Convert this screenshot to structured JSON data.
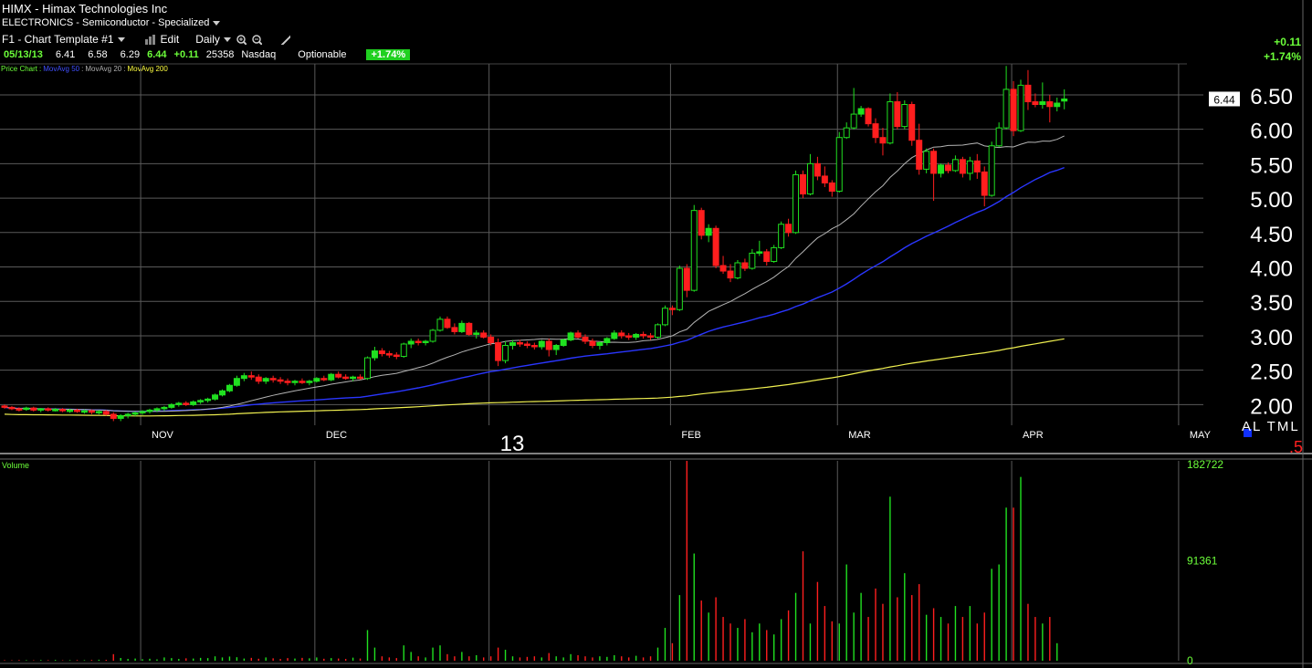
{
  "header": {
    "symbol": "HIMX",
    "company": "Himax Technologies Inc",
    "sector": "ELECTRONICS - Semiconductor - Specialized",
    "template": "F1 - Chart Template #1",
    "edit_label": "Edit",
    "period_label": "Daily",
    "quote": {
      "date": "05/13/13",
      "open": "6.41",
      "high": "6.58",
      "low": "6.29",
      "last": "6.44",
      "change": "+0.11",
      "volume": "25358",
      "exchange": "Nasdaq",
      "optionable": "Optionable",
      "pct_badge": "+1.74%"
    },
    "right_change": "+0.11",
    "right_pct": "+1.74%"
  },
  "legend": {
    "price_chart": "Price Chart",
    "ma50": "MovAvg 50",
    "ma20": "MovAvg 20",
    "ma200": "MovAvg 200"
  },
  "volume_label": "Volume",
  "altml": "AL TML",
  "red_label": ".5",
  "colors": {
    "up": "#20e020",
    "down": "#ff1e1e",
    "ma20": "#b4b4b4",
    "ma50": "#2a36ff",
    "ma200": "#f0f050",
    "grid": "#5a5a5a"
  },
  "chart_data": {
    "type": "candlestick",
    "price_axis": {
      "ticks": [
        "6.50",
        "6.00",
        "5.50",
        "5.00",
        "4.50",
        "4.00",
        "3.50",
        "3.00",
        "2.50",
        "2.00"
      ],
      "tick_values": [
        6.5,
        6.0,
        5.5,
        5.0,
        4.5,
        4.0,
        3.5,
        3.0,
        2.5,
        2.0
      ],
      "last_price_label": "6.44",
      "ylim": [
        1.7,
        6.95
      ]
    },
    "x_axis": {
      "labels": [
        "NOV",
        "DEC",
        "13",
        "FEB",
        "MAR",
        "APR",
        "MAY"
      ],
      "label_bar_index": [
        19,
        43,
        67,
        92,
        115,
        139,
        162
      ]
    },
    "volume_axis": {
      "ticks": [
        "182722",
        "91361",
        "0"
      ],
      "tick_values": [
        182722,
        91361,
        0
      ]
    },
    "candles": [
      [
        1.98,
        2.0,
        1.94,
        1.96
      ],
      [
        1.96,
        1.98,
        1.92,
        1.94
      ],
      [
        1.94,
        1.96,
        1.9,
        1.93
      ],
      [
        1.93,
        1.97,
        1.91,
        1.95
      ],
      [
        1.95,
        1.97,
        1.9,
        1.92
      ],
      [
        1.92,
        1.95,
        1.89,
        1.94
      ],
      [
        1.94,
        1.96,
        1.9,
        1.92
      ],
      [
        1.92,
        1.95,
        1.9,
        1.93
      ],
      [
        1.93,
        1.95,
        1.89,
        1.91
      ],
      [
        1.91,
        1.94,
        1.88,
        1.92
      ],
      [
        1.92,
        1.94,
        1.88,
        1.9
      ],
      [
        1.9,
        1.93,
        1.87,
        1.91
      ],
      [
        1.91,
        1.93,
        1.86,
        1.89
      ],
      [
        1.89,
        1.92,
        1.86,
        1.9
      ],
      [
        1.9,
        1.92,
        1.84,
        1.86
      ],
      [
        1.86,
        1.89,
        1.76,
        1.8
      ],
      [
        1.8,
        1.86,
        1.76,
        1.84
      ],
      [
        1.84,
        1.88,
        1.8,
        1.86
      ],
      [
        1.86,
        1.9,
        1.83,
        1.88
      ],
      [
        1.88,
        1.92,
        1.85,
        1.9
      ],
      [
        1.9,
        1.94,
        1.87,
        1.92
      ],
      [
        1.92,
        1.96,
        1.89,
        1.94
      ],
      [
        1.94,
        1.98,
        1.91,
        1.96
      ],
      [
        1.96,
        2.02,
        1.94,
        2.0
      ],
      [
        2.0,
        2.04,
        1.97,
        2.02
      ],
      [
        2.02,
        2.05,
        1.98,
        2.0
      ],
      [
        2.0,
        2.06,
        1.98,
        2.04
      ],
      [
        2.04,
        2.08,
        2.01,
        2.06
      ],
      [
        2.06,
        2.1,
        2.03,
        2.08
      ],
      [
        2.08,
        2.16,
        2.06,
        2.14
      ],
      [
        2.14,
        2.22,
        2.12,
        2.2
      ],
      [
        2.2,
        2.3,
        2.18,
        2.28
      ],
      [
        2.28,
        2.42,
        2.26,
        2.38
      ],
      [
        2.38,
        2.46,
        2.34,
        2.42
      ],
      [
        2.42,
        2.48,
        2.36,
        2.4
      ],
      [
        2.4,
        2.44,
        2.3,
        2.34
      ],
      [
        2.34,
        2.4,
        2.3,
        2.38
      ],
      [
        2.38,
        2.42,
        2.32,
        2.36
      ],
      [
        2.36,
        2.4,
        2.3,
        2.34
      ],
      [
        2.34,
        2.38,
        2.28,
        2.32
      ],
      [
        2.32,
        2.36,
        2.28,
        2.34
      ],
      [
        2.34,
        2.38,
        2.3,
        2.32
      ],
      [
        2.32,
        2.36,
        2.28,
        2.34
      ],
      [
        2.34,
        2.4,
        2.32,
        2.38
      ],
      [
        2.38,
        2.42,
        2.34,
        2.36
      ],
      [
        2.36,
        2.46,
        2.34,
        2.44
      ],
      [
        2.44,
        2.48,
        2.38,
        2.4
      ],
      [
        2.4,
        2.44,
        2.36,
        2.38
      ],
      [
        2.38,
        2.42,
        2.34,
        2.4
      ],
      [
        2.4,
        2.44,
        2.36,
        2.38
      ],
      [
        2.38,
        2.7,
        2.36,
        2.68
      ],
      [
        2.68,
        2.84,
        2.64,
        2.78
      ],
      [
        2.78,
        2.82,
        2.7,
        2.74
      ],
      [
        2.74,
        2.78,
        2.68,
        2.72
      ],
      [
        2.72,
        2.76,
        2.66,
        2.7
      ],
      [
        2.7,
        2.9,
        2.68,
        2.88
      ],
      [
        2.88,
        2.96,
        2.82,
        2.92
      ],
      [
        2.92,
        2.96,
        2.86,
        2.9
      ],
      [
        2.9,
        2.94,
        2.86,
        2.92
      ],
      [
        2.92,
        3.1,
        2.9,
        3.08
      ],
      [
        3.08,
        3.28,
        3.06,
        3.24
      ],
      [
        3.24,
        3.28,
        3.1,
        3.12
      ],
      [
        3.12,
        3.18,
        3.02,
        3.06
      ],
      [
        3.06,
        3.22,
        3.04,
        3.18
      ],
      [
        3.18,
        3.2,
        3.0,
        3.02
      ],
      [
        3.02,
        3.08,
        2.96,
        3.04
      ],
      [
        3.04,
        3.08,
        2.96,
        2.98
      ],
      [
        2.98,
        3.02,
        2.86,
        2.9
      ],
      [
        2.9,
        2.96,
        2.56,
        2.64
      ],
      [
        2.64,
        2.92,
        2.6,
        2.86
      ],
      [
        2.86,
        2.94,
        2.8,
        2.9
      ],
      [
        2.9,
        2.94,
        2.84,
        2.88
      ],
      [
        2.88,
        2.92,
        2.82,
        2.86
      ],
      [
        2.86,
        2.9,
        2.8,
        2.84
      ],
      [
        2.84,
        2.94,
        2.8,
        2.92
      ],
      [
        2.92,
        2.96,
        2.7,
        2.8
      ],
      [
        2.8,
        2.88,
        2.72,
        2.86
      ],
      [
        2.86,
        2.96,
        2.84,
        2.94
      ],
      [
        2.94,
        3.06,
        2.92,
        3.04
      ],
      [
        3.04,
        3.08,
        2.96,
        2.98
      ],
      [
        2.98,
        3.02,
        2.88,
        2.92
      ],
      [
        2.92,
        2.96,
        2.82,
        2.86
      ],
      [
        2.86,
        2.92,
        2.8,
        2.9
      ],
      [
        2.9,
        2.98,
        2.86,
        2.96
      ],
      [
        2.96,
        3.08,
        2.94,
        3.04
      ],
      [
        3.04,
        3.08,
        2.96,
        3.0
      ],
      [
        3.0,
        3.04,
        2.94,
        2.98
      ],
      [
        2.98,
        3.04,
        2.94,
        3.02
      ],
      [
        3.02,
        3.06,
        2.96,
        3.0
      ],
      [
        3.0,
        3.04,
        2.94,
        2.98
      ],
      [
        2.98,
        3.18,
        2.96,
        3.16
      ],
      [
        3.16,
        3.44,
        3.14,
        3.4
      ],
      [
        3.4,
        3.44,
        3.3,
        3.38
      ],
      [
        3.38,
        4.02,
        3.36,
        3.98
      ],
      [
        3.98,
        4.04,
        3.56,
        3.66
      ],
      [
        3.66,
        4.9,
        3.64,
        4.82
      ],
      [
        4.82,
        4.86,
        4.4,
        4.46
      ],
      [
        4.46,
        4.62,
        4.36,
        4.56
      ],
      [
        4.56,
        4.6,
        3.98,
        4.02
      ],
      [
        4.02,
        4.16,
        3.9,
        3.94
      ],
      [
        3.94,
        4.04,
        3.78,
        3.84
      ],
      [
        3.84,
        4.1,
        3.82,
        4.06
      ],
      [
        4.06,
        4.12,
        3.94,
        3.98
      ],
      [
        3.98,
        4.26,
        3.96,
        4.2
      ],
      [
        4.2,
        4.38,
        4.16,
        4.22
      ],
      [
        4.22,
        4.26,
        4.02,
        4.08
      ],
      [
        4.08,
        4.32,
        4.06,
        4.28
      ],
      [
        4.28,
        4.66,
        4.26,
        4.62
      ],
      [
        4.62,
        4.7,
        4.44,
        4.5
      ],
      [
        4.5,
        5.4,
        4.48,
        5.34
      ],
      [
        5.34,
        5.4,
        5.0,
        5.06
      ],
      [
        5.06,
        5.64,
        5.04,
        5.5
      ],
      [
        5.5,
        5.6,
        5.26,
        5.32
      ],
      [
        5.32,
        5.46,
        5.16,
        5.22
      ],
      [
        5.22,
        5.26,
        5.02,
        5.1
      ],
      [
        5.1,
        5.96,
        5.08,
        5.88
      ],
      [
        5.88,
        6.1,
        5.86,
        6.02
      ],
      [
        6.02,
        6.6,
        6.0,
        6.22
      ],
      [
        6.22,
        6.34,
        6.18,
        6.3
      ],
      [
        6.3,
        6.32,
        6.04,
        6.08
      ],
      [
        6.08,
        6.16,
        5.8,
        5.88
      ],
      [
        5.88,
        6.02,
        5.62,
        5.8
      ],
      [
        5.8,
        6.52,
        5.78,
        6.4
      ],
      [
        6.4,
        6.54,
        6.0,
        6.04
      ],
      [
        6.04,
        6.42,
        6.0,
        6.36
      ],
      [
        6.36,
        6.4,
        5.76,
        5.84
      ],
      [
        5.84,
        6.08,
        5.34,
        5.42
      ],
      [
        5.42,
        5.72,
        5.36,
        5.68
      ],
      [
        5.68,
        5.72,
        4.96,
        5.36
      ],
      [
        5.36,
        5.5,
        5.3,
        5.48
      ],
      [
        5.48,
        5.52,
        5.36,
        5.4
      ],
      [
        5.4,
        5.62,
        5.38,
        5.56
      ],
      [
        5.56,
        5.6,
        5.3,
        5.36
      ],
      [
        5.36,
        5.6,
        5.26,
        5.54
      ],
      [
        5.54,
        5.64,
        5.28,
        5.38
      ],
      [
        5.38,
        5.46,
        4.88,
        5.04
      ],
      [
        5.04,
        5.82,
        5.02,
        5.76
      ],
      [
        5.76,
        6.1,
        5.74,
        6.02
      ],
      [
        6.02,
        6.92,
        6.0,
        6.58
      ],
      [
        6.58,
        6.7,
        5.9,
        5.98
      ],
      [
        5.98,
        6.72,
        5.96,
        6.64
      ],
      [
        6.64,
        6.86,
        6.28,
        6.4
      ],
      [
        6.4,
        6.52,
        6.32,
        6.36
      ],
      [
        6.36,
        6.68,
        6.3,
        6.4
      ],
      [
        6.4,
        6.5,
        6.1,
        6.33
      ],
      [
        6.33,
        6.46,
        6.26,
        6.38
      ],
      [
        6.41,
        6.58,
        6.29,
        6.44
      ]
    ],
    "volumes": [
      500,
      400,
      600,
      500,
      400,
      600,
      500,
      700,
      400,
      500,
      600,
      500,
      700,
      900,
      800,
      6000,
      2500,
      1600,
      2000,
      1400,
      1800,
      1200,
      3000,
      2400,
      1600,
      2200,
      2000,
      2600,
      2400,
      4000,
      3000,
      3800,
      3200,
      2000,
      2600,
      1800,
      3000,
      2200,
      1600,
      2400,
      2000,
      2600,
      2200,
      3000,
      1800,
      2400,
      2000,
      1600,
      2800,
      2000,
      28000,
      12000,
      4000,
      3000,
      2400,
      14000,
      8000,
      4000,
      3000,
      12000,
      14000,
      6000,
      4000,
      8000,
      4000,
      5000,
      3000,
      4000,
      12000,
      10000,
      4000,
      3000,
      3500,
      4000,
      3000,
      7000,
      4000,
      3000,
      6000,
      5000,
      4000,
      3000,
      4000,
      3500,
      5000,
      4000,
      3000,
      4500,
      3000,
      4000,
      12000,
      30000,
      16000,
      60000,
      182722,
      98000,
      55000,
      44000,
      58000,
      40000,
      34000,
      30000,
      38000,
      26000,
      34000,
      28000,
      24000,
      38000,
      46000,
      62000,
      100000,
      34000,
      72000,
      50000,
      36000,
      34000,
      88000,
      44000,
      62000,
      40000,
      66000,
      52000,
      150000,
      58000,
      80000,
      60000,
      70000,
      42000,
      48000,
      40000,
      34000,
      50000,
      40000,
      50000,
      34000,
      44000,
      84000,
      88000,
      140000,
      140000,
      168000,
      52000,
      40000,
      34000,
      40000,
      16000
    ]
  }
}
